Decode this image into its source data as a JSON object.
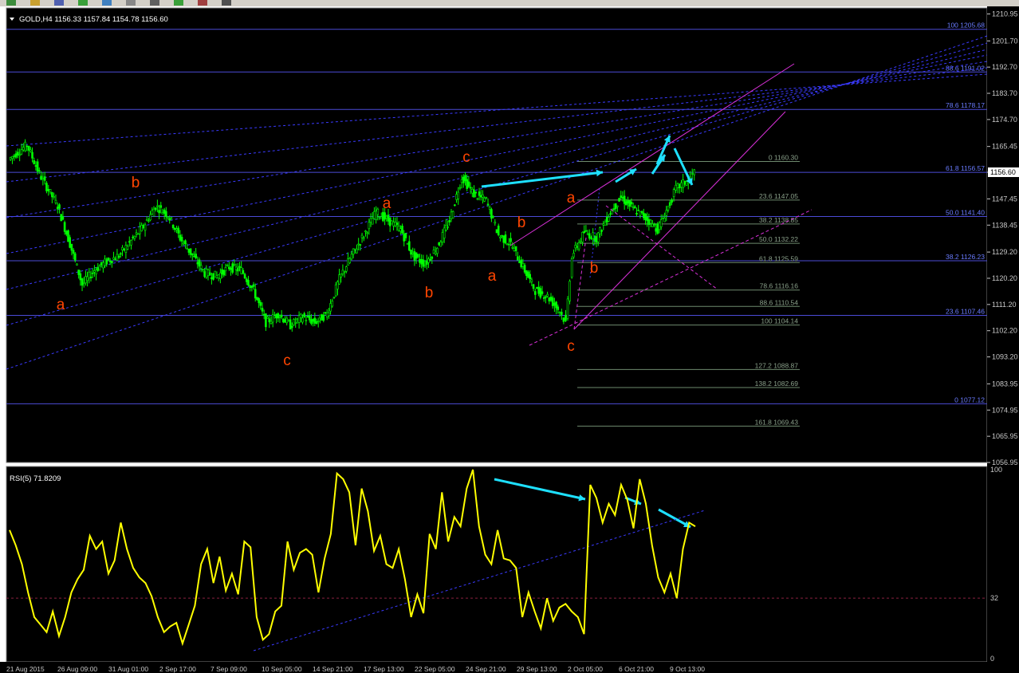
{
  "window": {
    "symbol_header": "GOLD,H4  1156.33 1157.84 1154.78 1156.60",
    "current_price": "1156.60"
  },
  "toolbar": {
    "icons": [
      "new-chart-icon",
      "profiles-icon",
      "open-icon",
      "save-icon",
      "print-icon",
      "market-watch-icon",
      "terminal-icon",
      "add-icon",
      "history-icon",
      "expert-icon"
    ]
  },
  "colors": {
    "background": "#000000",
    "candle": "#00ff00",
    "rsi_line": "#ffff00",
    "fib_main": "#4b4bd6",
    "fib_secondary": "#6e8a6e",
    "channel": "#3a3aff",
    "trend_magenta": "#d930d9",
    "arrow": "#1ee0ff",
    "wave_label": "#ff4500",
    "axis_text": "#c8c8c8"
  },
  "chart_data": [
    {
      "type": "line",
      "description_source": "GOLD H4 price chart (drawn as candles)",
      "title": "GOLD,H4  1156.33 1157.84 1154.78 1156.60",
      "ylim": [
        1056.95,
        1213.0
      ],
      "y_ticks": [
        "1210.95",
        "1201.70",
        "1192.70",
        "1183.70",
        "1174.70",
        "1165.45",
        "1156.60",
        "1147.45",
        "1138.45",
        "1129.20",
        "1120.20",
        "1111.20",
        "1102.20",
        "1093.20",
        "1083.95",
        "1074.95",
        "1065.95",
        "1056.95"
      ],
      "x_ticks": [
        "21 Aug 2015",
        "26 Aug 09:00",
        "31 Aug 01:00",
        "2 Sep 17:00",
        "7 Sep 09:00",
        "10 Sep 05:00",
        "14 Sep 21:00",
        "17 Sep 13:00",
        "22 Sep 05:00",
        "24 Sep 21:00",
        "29 Sep 13:00",
        "2 Oct 05:00",
        "6 Oct 21:00",
        "9 Oct 13:00"
      ],
      "price_path": [
        [
          0,
          1161
        ],
        [
          3,
          1166
        ],
        [
          5,
          1156
        ],
        [
          8,
          1145
        ],
        [
          10,
          1132
        ],
        [
          12,
          1118
        ],
        [
          14,
          1123
        ],
        [
          16,
          1126
        ],
        [
          18,
          1128
        ],
        [
          20,
          1133
        ],
        [
          22,
          1138
        ],
        [
          24,
          1145
        ],
        [
          26,
          1142
        ],
        [
          28,
          1134
        ],
        [
          30,
          1128
        ],
        [
          32,
          1122
        ],
        [
          34,
          1121
        ],
        [
          36,
          1124
        ],
        [
          38,
          1123
        ],
        [
          40,
          1116
        ],
        [
          42,
          1105
        ],
        [
          44,
          1108
        ],
        [
          46,
          1104
        ],
        [
          48,
          1107
        ],
        [
          50,
          1105
        ],
        [
          52,
          1108
        ],
        [
          54,
          1120
        ],
        [
          56,
          1128
        ],
        [
          58,
          1135
        ],
        [
          60,
          1143
        ],
        [
          62,
          1140
        ],
        [
          64,
          1137
        ],
        [
          66,
          1128
        ],
        [
          68,
          1125
        ],
        [
          70,
          1131
        ],
        [
          72,
          1140
        ],
        [
          74,
          1155
        ],
        [
          76,
          1149
        ],
        [
          78,
          1147
        ],
        [
          80,
          1135
        ],
        [
          82,
          1132
        ],
        [
          84,
          1124
        ],
        [
          86,
          1116
        ],
        [
          88,
          1114
        ],
        [
          90,
          1109
        ],
        [
          91,
          1105
        ],
        [
          92,
          1128
        ],
        [
          94,
          1136
        ],
        [
          96,
          1134
        ],
        [
          98,
          1142
        ],
        [
          100,
          1148
        ],
        [
          102,
          1144
        ],
        [
          104,
          1141
        ],
        [
          106,
          1137
        ],
        [
          108,
          1146
        ],
        [
          109,
          1151
        ],
        [
          111,
          1154
        ],
        [
          112,
          1156.6
        ]
      ],
      "fib_levels_right": [
        {
          "label": "100 1205.68",
          "value": 1205.68
        },
        {
          "label": "88.6 1191.02",
          "value": 1191.02
        },
        {
          "label": "78.6 1178.17",
          "value": 1178.17
        },
        {
          "label": "61.8 1156.57",
          "value": 1156.57
        },
        {
          "label": "50.0 1141.40",
          "value": 1141.4
        },
        {
          "label": "38.2 1126.23",
          "value": 1126.23
        },
        {
          "label": "23.6 1107.46",
          "value": 1107.46
        },
        {
          "label": "0 1077.12",
          "value": 1077.12
        }
      ],
      "fib_levels_inner": [
        {
          "label": "0 1160.30",
          "value": 1160.3
        },
        {
          "label": "23.6 1147.05",
          "value": 1147.05
        },
        {
          "label": "38.2 1138.85",
          "value": 1138.85
        },
        {
          "label": "50.0 1132.22",
          "value": 1132.22
        },
        {
          "label": "61.8 1125.59",
          "value": 1125.59
        },
        {
          "label": "78.6 1116.16",
          "value": 1116.16
        },
        {
          "label": "88.6 1110.54",
          "value": 1110.54
        },
        {
          "label": "100 1104.14",
          "value": 1104.14
        },
        {
          "label": "127.2 1088.87",
          "value": 1088.87
        },
        {
          "label": "138.2 1082.69",
          "value": 1082.69
        },
        {
          "label": "161.8 1069.43",
          "value": 1069.43
        }
      ],
      "wave_labels": [
        {
          "text": "a",
          "price": 1111
        },
        {
          "text": "b",
          "price": 1152
        },
        {
          "text": "c",
          "price": 1095
        },
        {
          "text": "a",
          "price": 1145
        },
        {
          "text": "b",
          "price": 1116
        },
        {
          "text": "c",
          "price": 1162
        },
        {
          "text": "b",
          "price": 1138
        },
        {
          "text": "a",
          "price": 1120
        },
        {
          "text": "a",
          "price": 1146
        },
        {
          "text": "b",
          "price": 1124
        },
        {
          "text": "c",
          "price": 1099
        }
      ]
    },
    {
      "type": "line",
      "title": "RSI(5) 71.8209",
      "ylim": [
        0,
        100
      ],
      "y_ticks": [
        "100",
        "32",
        "0"
      ],
      "level": 32,
      "values": [
        68,
        60,
        50,
        35,
        22,
        18,
        14,
        25,
        12,
        22,
        35,
        42,
        47,
        65,
        58,
        62,
        45,
        52,
        72,
        58,
        48,
        43,
        40,
        33,
        22,
        14,
        17,
        19,
        8,
        18,
        28,
        50,
        58,
        40,
        54,
        36,
        45,
        34,
        62,
        59,
        22,
        10,
        13,
        25,
        28,
        62,
        47,
        56,
        58,
        55,
        35,
        53,
        66,
        98,
        95,
        88,
        60,
        90,
        78,
        57,
        65,
        50,
        48,
        58,
        42,
        22,
        34,
        24,
        66,
        58,
        88,
        62,
        75,
        70,
        90,
        100,
        70,
        55,
        50,
        68,
        53,
        52,
        48,
        22,
        35,
        25,
        16,
        32,
        20,
        27,
        29,
        25,
        22,
        13,
        92,
        85,
        72,
        82,
        76,
        92,
        84,
        69,
        95,
        82,
        60,
        43,
        35,
        45,
        32,
        58,
        72,
        70
      ]
    }
  ]
}
